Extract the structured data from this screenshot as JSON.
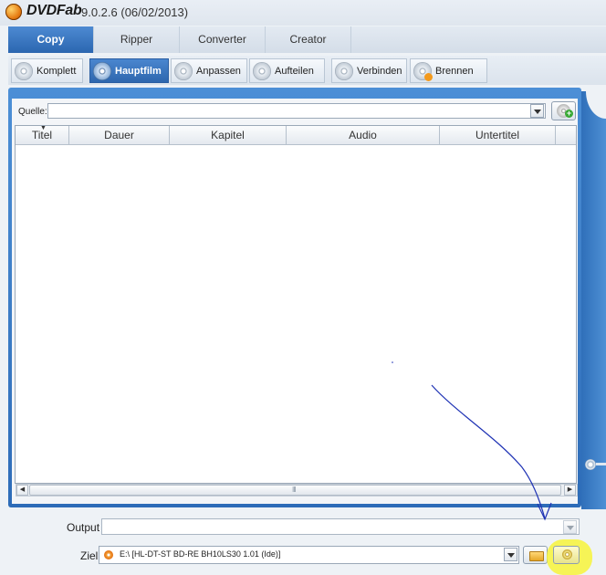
{
  "title": {
    "app_name": "DVDFab",
    "version": "9.0.2.6 (06/02/2013)"
  },
  "main_tabs": [
    "Copy",
    "Ripper",
    "Converter",
    "Creator"
  ],
  "active_main_tab": "Copy",
  "sub_tabs": [
    "Komplett",
    "Hauptfilm",
    "Anpassen",
    "Aufteilen",
    "Verbinden",
    "Brennen"
  ],
  "active_sub_tab": "Hauptfilm",
  "source": {
    "label": "Quelle:",
    "value": ""
  },
  "table": {
    "columns": [
      "Titel",
      "Dauer",
      "Kapitel",
      "Audio",
      "Untertitel"
    ],
    "rows": []
  },
  "output": {
    "label": "Output",
    "value": ""
  },
  "target": {
    "label": "Ziel:",
    "value": "E:\\ [HL-DT-ST BD-RE  BH10LS30 1.01 (Ide)]"
  },
  "colors": {
    "accent": "#2e6ab3",
    "highlight": "#f7f43a",
    "annotation": "#1e32b4"
  },
  "icons": [
    "dvdfab-logo-icon",
    "disc-icon",
    "add-source-icon",
    "folder-icon",
    "burn-disc-icon"
  ]
}
